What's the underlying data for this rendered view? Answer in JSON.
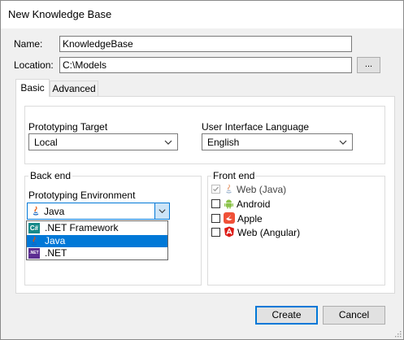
{
  "window": {
    "title": "New Knowledge Base"
  },
  "form": {
    "name_label": "Name:",
    "name_value": "KnowledgeBase",
    "location_label": "Location:",
    "location_value": "C:\\Models",
    "browse_label": "..."
  },
  "tabs": [
    {
      "label": "Basic",
      "selected": true
    },
    {
      "label": "Advanced",
      "selected": false
    }
  ],
  "basic": {
    "prototyping_target_label": "Prototyping Target",
    "prototyping_target_value": "Local",
    "ui_language_label": "User Interface Language",
    "ui_language_value": "English"
  },
  "backend": {
    "title": "Back end",
    "env_label": "Prototyping Environment",
    "env_value": "Java",
    "options": [
      {
        "label": ".NET Framework",
        "icon": "csharp-icon",
        "icon_text": "C#",
        "selected": false
      },
      {
        "label": "Java",
        "icon": "java-icon",
        "selected": true
      },
      {
        "label": ".NET",
        "icon": "dotnet-icon",
        "icon_text": ".NET",
        "selected": false
      }
    ]
  },
  "frontend": {
    "title": "Front end",
    "items": [
      {
        "label": "Web (Java)",
        "icon": "java-icon",
        "checked": true,
        "disabled": true
      },
      {
        "label": "Android",
        "icon": "android-icon",
        "checked": false,
        "disabled": false
      },
      {
        "label": "Apple",
        "icon": "swift-icon",
        "checked": false,
        "disabled": false
      },
      {
        "label": "Web (Angular)",
        "icon": "angular-icon",
        "checked": false,
        "disabled": false
      }
    ]
  },
  "buttons": {
    "create": "Create",
    "cancel": "Cancel"
  },
  "colors": {
    "accent": "#0078d7",
    "dialog_bg": "#f0f0f0",
    "android": "#8bc34a",
    "swift": "#f05138",
    "angular": "#dd1b16",
    "csharp": "#178a8a",
    "dotnet": "#5c2d91"
  }
}
